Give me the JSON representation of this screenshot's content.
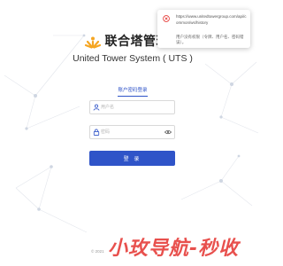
{
  "brand": {
    "name": "联合塔管理系",
    "system_name": "United Tower System ( UTS )"
  },
  "login": {
    "tab_label": "账户密码登录",
    "username_placeholder": "用户名",
    "password_placeholder": "密码",
    "submit_label": "登 录"
  },
  "footer": {
    "copyright": "© 2021"
  },
  "watermark": {
    "text": "小玫导航-秒收"
  },
  "notification": {
    "url": "https://www.unitedtowergroup.com/api/common/ws/history",
    "message": "用户没有权限（令牌、用户名、密码错误）。"
  },
  "colors": {
    "primary": "#2f54c8",
    "error": "#e53935",
    "watermark": "#e53935",
    "logo": "#f5a623"
  },
  "icons": {
    "user": "user-icon",
    "lock": "lock-icon",
    "eye": "eye-icon",
    "error": "error-circle-icon",
    "logo": "sun-rays-logo"
  }
}
